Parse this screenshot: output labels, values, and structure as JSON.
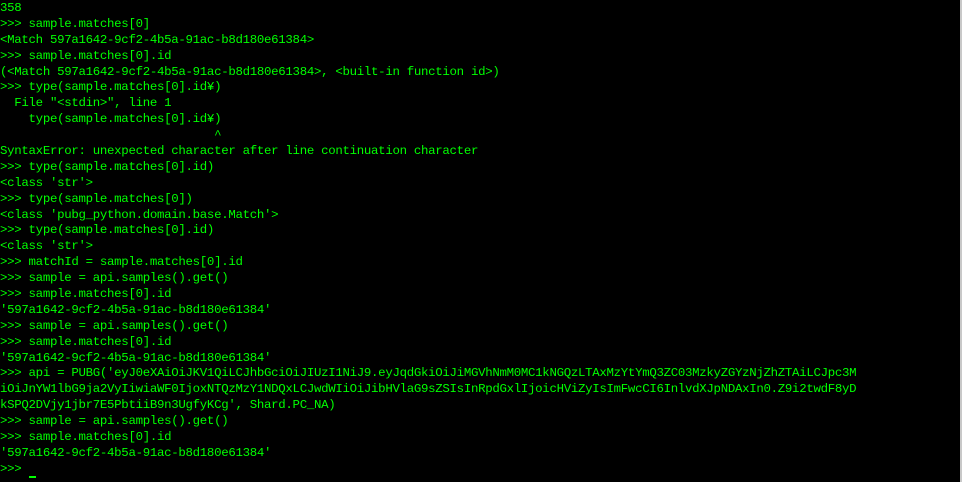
{
  "colors": {
    "background": "#000000",
    "text": "#00ff00"
  },
  "lines": [
    "358",
    ">>> sample.matches[0]",
    "<Match 597a1642-9cf2-4b5a-91ac-b8d180e61384>",
    ">>> sample.matches[0].id",
    "(<Match 597a1642-9cf2-4b5a-91ac-b8d180e61384>, <built-in function id>)",
    ">>> type(sample.matches[0].id¥)",
    "  File \"<stdin>\", line 1",
    "    type(sample.matches[0].id¥)",
    "                              ^",
    "SyntaxError: unexpected character after line continuation character",
    ">>> type(sample.matches[0].id)",
    "<class 'str'>",
    ">>> type(sample.matches[0])",
    "<class 'pubg_python.domain.base.Match'>",
    ">>> type(sample.matches[0].id)",
    "<class 'str'>",
    ">>> matchId = sample.matches[0].id",
    ">>> sample = api.samples().get()",
    ">>> sample.matches[0].id",
    "'597a1642-9cf2-4b5a-91ac-b8d180e61384'",
    ">>> sample = api.samples().get()",
    ">>> sample.matches[0].id",
    "'597a1642-9cf2-4b5a-91ac-b8d180e61384'",
    ">>> api = PUBG('eyJ0eXAiOiJKV1QiLCJhbGciOiJIUzI1NiJ9.eyJqdGkiOiJiMGVhNmM0MC1kNGQzLTAxMzYtYmQ3ZC03MzkyZGYzNjZhZTAiLCJpc3M",
    "iOiJnYW1lbG9ja2VyIiwiaWF0IjoxNTQzMzY1NDQxLCJwdWIiOiJibHVlaG9sZSIsInRpdGxlIjoicHViZyIsImFwcCI6InlvdXJpNDAxIn0.Z9i2twdF8yD",
    "kSPQ2DVjy1jbr7E5PbtiiB9n3UgfyKCg', Shard.PC_NA)",
    ">>> sample = api.samples().get()",
    ">>> sample.matches[0].id",
    "'597a1642-9cf2-4b5a-91ac-b8d180e61384'",
    ">>> "
  ]
}
